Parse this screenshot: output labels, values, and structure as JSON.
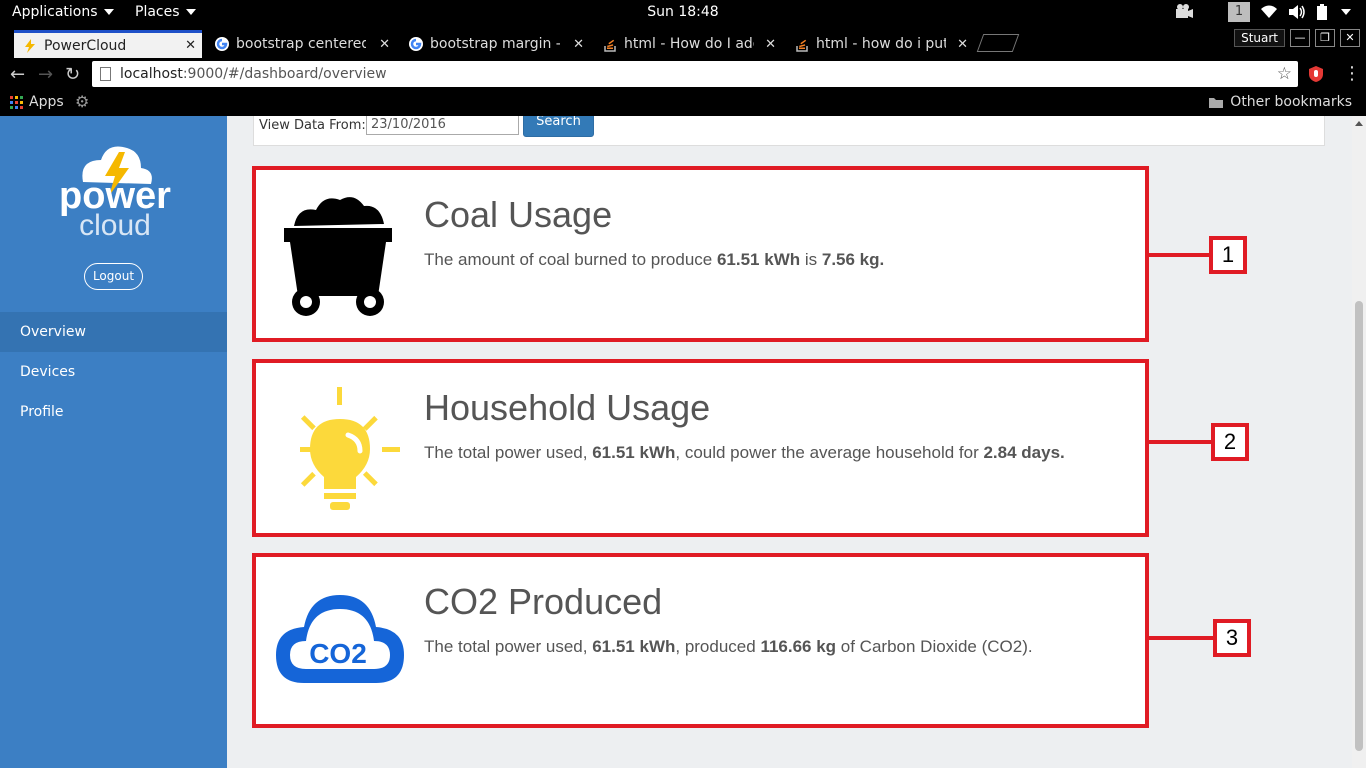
{
  "topbar": {
    "applications": "Applications",
    "places": "Places",
    "clock": "Sun 18:48",
    "workspace": "1"
  },
  "tabs": [
    {
      "title": "PowerCloud",
      "active": true
    },
    {
      "title": "bootstrap centered i",
      "active": false
    },
    {
      "title": "bootstrap margin - G",
      "active": false
    },
    {
      "title": "html - How do I add",
      "active": false
    },
    {
      "title": "html - how do i put n",
      "active": false
    }
  ],
  "window": {
    "profile": "Stuart"
  },
  "address": {
    "host": "localhost",
    "path": ":9000/#/dashboard/overview"
  },
  "bookmarks": {
    "apps": "Apps",
    "other": "Other bookmarks"
  },
  "sidebar": {
    "logo_top": "power",
    "logo_bottom": "cloud",
    "logout": "Logout",
    "items": [
      {
        "label": "Overview",
        "active": true
      },
      {
        "label": "Devices",
        "active": false
      },
      {
        "label": "Profile",
        "active": false
      }
    ]
  },
  "filter": {
    "label": "View Data From:",
    "date": "23/10/2016",
    "search": "Search"
  },
  "cards": [
    {
      "title": "Coal Usage",
      "text1": "The amount of coal burned to produce ",
      "b1": "61.51 kWh",
      "text2": " is ",
      "b2": "7.56 kg.",
      "text3": "",
      "marker": "1"
    },
    {
      "title": "Household Usage",
      "text1": "The total power used, ",
      "b1": "61.51 kWh",
      "text2": ", could power the average household for ",
      "b2": "2.84 days.",
      "text3": "",
      "marker": "2"
    },
    {
      "title": "CO2 Produced",
      "text1": "The total power used, ",
      "b1": "61.51 kWh",
      "text2": ", produced ",
      "b2": "116.66 kg",
      "text3": " of Carbon Dioxide (CO2).",
      "marker": "3"
    }
  ],
  "co2_label": "CO2",
  "colors": {
    "accent_red": "#e01b24",
    "sidebar_blue": "#3c7fc4",
    "bulb_yellow": "#fcd93b",
    "co2_blue": "#1565d8"
  }
}
